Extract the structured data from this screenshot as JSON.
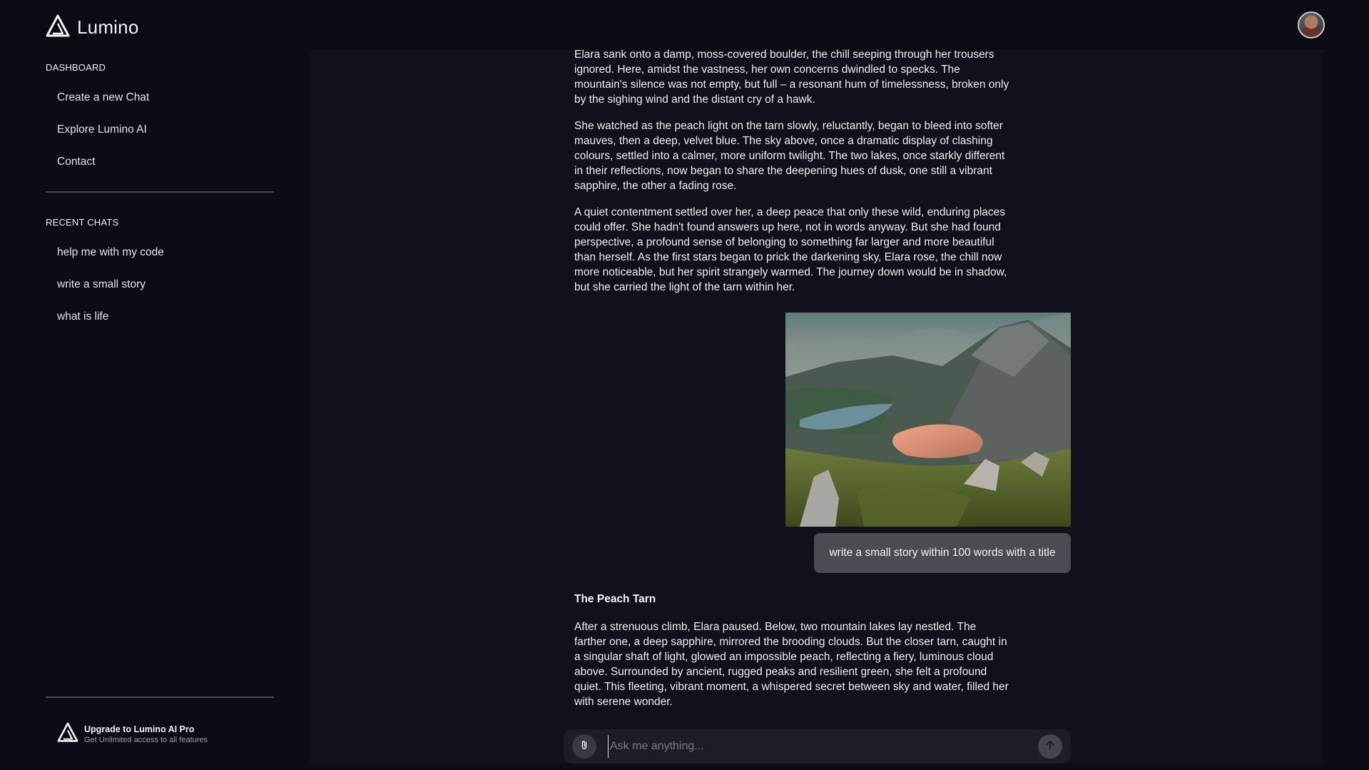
{
  "brand": {
    "name": "Lumino"
  },
  "sidebar": {
    "dashboard_title": "DASHBOARD",
    "nav": [
      {
        "label": "Create a new Chat"
      },
      {
        "label": "Explore Lumino AI"
      },
      {
        "label": "Contact"
      }
    ],
    "recent_title": "RECENT CHATS",
    "recent": [
      {
        "label": "help me with my code"
      },
      {
        "label": "write a small story"
      },
      {
        "label": "what is life"
      }
    ],
    "upgrade": {
      "title": "Upgrade to Lumino AI Pro",
      "subtitle": "Get Unlimited access to all features"
    }
  },
  "chat": {
    "earlier_paragraphs": [
      "Elara sank onto a damp, moss-covered boulder, the chill seeping through her trousers ignored. Here, amidst the vastness, her own concerns dwindled to specks. The mountain's silence was not empty, but full – a resonant hum of timelessness, broken only by the sighing wind and the distant cry of a hawk.",
      "She watched as the peach light on the tarn slowly, reluctantly, began to bleed into softer mauves, then a deep, velvet blue. The sky above, once a dramatic display of clashing colours, settled into a calmer, more uniform twilight. The two lakes, once starkly different in their reflections, now began to share the deepening hues of dusk, one still a vibrant sapphire, the other a fading rose.",
      "A quiet contentment settled over her, a deep peace that only these wild, enduring places could offer. She hadn't found answers up here, not in words anyway. But she had found perspective, a profound sense of belonging to something far larger and more beautiful than herself. As the first stars began to prick the darkening sky, Elara rose, the chill now more noticeable, but her spirit strangely warmed. The journey down would be in shadow, but she carried the light of the tarn within her."
    ],
    "user_message": "write a small story within 100 words with a title",
    "reply_title": "The Peach Tarn",
    "reply_body": "After a strenuous climb, Elara paused. Below, two mountain lakes lay nestled. The farther one, a deep sapphire, mirrored the brooding clouds. But the closer tarn, caught in a singular shaft of light, glowed an impossible peach, reflecting a fiery, luminous cloud above. Surrounded by ancient, rugged peaks and resilient green, she felt a profound quiet. This fleeting, vibrant moment, a whispered secret between sky and water, filled her with serene wonder."
  },
  "composer": {
    "placeholder": "Ask me anything...",
    "value": ""
  },
  "icons": {
    "logo": "lumino-logo-icon",
    "attach": "paperclip-icon",
    "send": "arrow-up-icon",
    "avatar": "user-avatar"
  },
  "colors": {
    "background": "#0c0c16",
    "panel": "#11111d",
    "user_bubble": "#4b4b52",
    "text": "#ececf0"
  }
}
